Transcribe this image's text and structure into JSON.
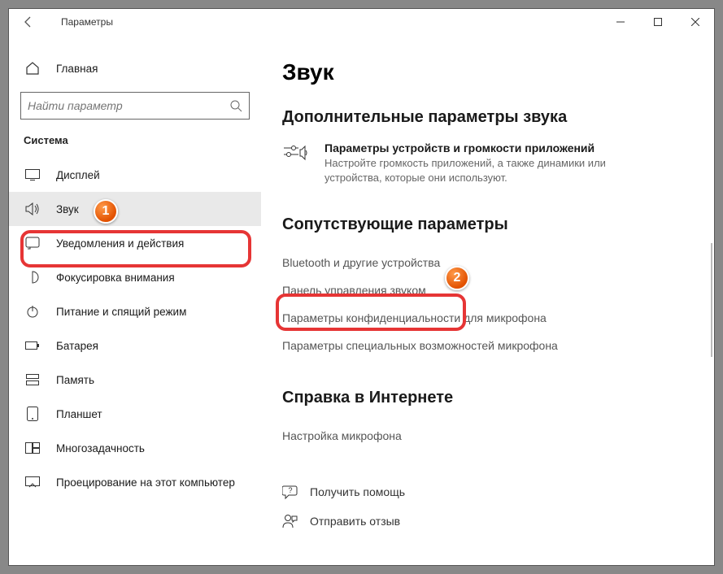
{
  "window": {
    "title": "Параметры"
  },
  "sidebar": {
    "home": "Главная",
    "search_placeholder": "Найти параметр",
    "section": "Система",
    "items": [
      {
        "label": "Дисплей"
      },
      {
        "label": "Звук"
      },
      {
        "label": "Уведомления и действия"
      },
      {
        "label": "Фокусировка внимания"
      },
      {
        "label": "Питание и спящий режим"
      },
      {
        "label": "Батарея"
      },
      {
        "label": "Память"
      },
      {
        "label": "Планшет"
      },
      {
        "label": "Многозадачность"
      },
      {
        "label": "Проецирование на этот компьютер"
      }
    ]
  },
  "main": {
    "title": "Звук",
    "advanced": {
      "heading": "Дополнительные параметры звука",
      "item_title": "Параметры устройств и громкости приложений",
      "item_desc": "Настройте громкость приложений, а также динамики или устройства, которые они используют."
    },
    "related": {
      "heading": "Сопутствующие параметры",
      "links": [
        "Bluetooth и другие устройства",
        "Панель управления звуком",
        "Параметры конфиденциальности для микрофона",
        "Параметры специальных возможностей микрофона"
      ]
    },
    "help": {
      "heading": "Справка в Интернете",
      "links": [
        "Настройка микрофона"
      ]
    },
    "footer": {
      "get_help": "Получить помощь",
      "feedback": "Отправить отзыв"
    }
  },
  "annotations": {
    "badge1": "1",
    "badge2": "2"
  }
}
